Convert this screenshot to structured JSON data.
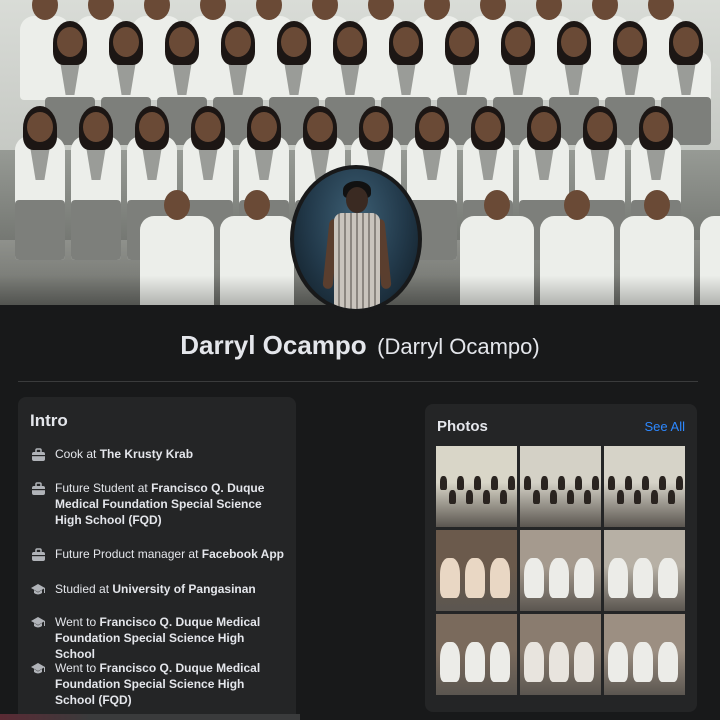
{
  "profile": {
    "name": "Darryl Ocampo",
    "alternate_name": "(Darryl Ocampo)"
  },
  "intro": {
    "title": "Intro",
    "items": [
      {
        "icon": "briefcase-icon",
        "prefix": "Cook at ",
        "bold": "The Krusty Krab",
        "suffix": ""
      },
      {
        "icon": "briefcase-icon",
        "prefix": "Future Student at ",
        "bold": "Francisco Q. Duque Medical Foundation Special Science High School (FQD)",
        "suffix": ""
      },
      {
        "icon": "briefcase-icon",
        "prefix": "Future Product manager at ",
        "bold": "Facebook App",
        "suffix": ""
      },
      {
        "icon": "graduation-cap-icon",
        "prefix": "Studied at ",
        "bold": "University of Pangasinan",
        "suffix": ""
      },
      {
        "icon": "graduation-cap-icon",
        "prefix": "Went to ",
        "bold": "Francisco Q. Duque Medical Foundation Special Science High School",
        "suffix": ""
      },
      {
        "icon": "graduation-cap-icon",
        "prefix": "Went to ",
        "bold": "Francisco Q. Duque Medical Foundation Special Science High School (FQD)",
        "suffix": ""
      }
    ]
  },
  "photos": {
    "title": "Photos",
    "see_all": "See All"
  },
  "colors": {
    "background": "#18191a",
    "card": "#242526",
    "text": "#e4e6eb",
    "link": "#2d88ff"
  }
}
